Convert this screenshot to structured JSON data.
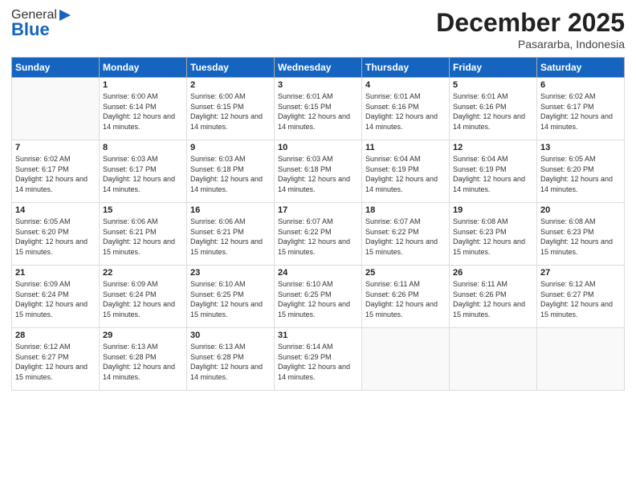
{
  "logo": {
    "general": "General",
    "blue": "Blue"
  },
  "title": "December 2025",
  "location": "Pasararba, Indonesia",
  "days_of_week": [
    "Sunday",
    "Monday",
    "Tuesday",
    "Wednesday",
    "Thursday",
    "Friday",
    "Saturday"
  ],
  "weeks": [
    [
      {
        "day": null,
        "sunrise": null,
        "sunset": null,
        "daylight": null
      },
      {
        "day": "1",
        "sunrise": "Sunrise: 6:00 AM",
        "sunset": "Sunset: 6:14 PM",
        "daylight": "Daylight: 12 hours and 14 minutes."
      },
      {
        "day": "2",
        "sunrise": "Sunrise: 6:00 AM",
        "sunset": "Sunset: 6:15 PM",
        "daylight": "Daylight: 12 hours and 14 minutes."
      },
      {
        "day": "3",
        "sunrise": "Sunrise: 6:01 AM",
        "sunset": "Sunset: 6:15 PM",
        "daylight": "Daylight: 12 hours and 14 minutes."
      },
      {
        "day": "4",
        "sunrise": "Sunrise: 6:01 AM",
        "sunset": "Sunset: 6:16 PM",
        "daylight": "Daylight: 12 hours and 14 minutes."
      },
      {
        "day": "5",
        "sunrise": "Sunrise: 6:01 AM",
        "sunset": "Sunset: 6:16 PM",
        "daylight": "Daylight: 12 hours and 14 minutes."
      },
      {
        "day": "6",
        "sunrise": "Sunrise: 6:02 AM",
        "sunset": "Sunset: 6:17 PM",
        "daylight": "Daylight: 12 hours and 14 minutes."
      }
    ],
    [
      {
        "day": "7",
        "sunrise": "Sunrise: 6:02 AM",
        "sunset": "Sunset: 6:17 PM",
        "daylight": "Daylight: 12 hours and 14 minutes."
      },
      {
        "day": "8",
        "sunrise": "Sunrise: 6:03 AM",
        "sunset": "Sunset: 6:17 PM",
        "daylight": "Daylight: 12 hours and 14 minutes."
      },
      {
        "day": "9",
        "sunrise": "Sunrise: 6:03 AM",
        "sunset": "Sunset: 6:18 PM",
        "daylight": "Daylight: 12 hours and 14 minutes."
      },
      {
        "day": "10",
        "sunrise": "Sunrise: 6:03 AM",
        "sunset": "Sunset: 6:18 PM",
        "daylight": "Daylight: 12 hours and 14 minutes."
      },
      {
        "day": "11",
        "sunrise": "Sunrise: 6:04 AM",
        "sunset": "Sunset: 6:19 PM",
        "daylight": "Daylight: 12 hours and 14 minutes."
      },
      {
        "day": "12",
        "sunrise": "Sunrise: 6:04 AM",
        "sunset": "Sunset: 6:19 PM",
        "daylight": "Daylight: 12 hours and 14 minutes."
      },
      {
        "day": "13",
        "sunrise": "Sunrise: 6:05 AM",
        "sunset": "Sunset: 6:20 PM",
        "daylight": "Daylight: 12 hours and 14 minutes."
      }
    ],
    [
      {
        "day": "14",
        "sunrise": "Sunrise: 6:05 AM",
        "sunset": "Sunset: 6:20 PM",
        "daylight": "Daylight: 12 hours and 15 minutes."
      },
      {
        "day": "15",
        "sunrise": "Sunrise: 6:06 AM",
        "sunset": "Sunset: 6:21 PM",
        "daylight": "Daylight: 12 hours and 15 minutes."
      },
      {
        "day": "16",
        "sunrise": "Sunrise: 6:06 AM",
        "sunset": "Sunset: 6:21 PM",
        "daylight": "Daylight: 12 hours and 15 minutes."
      },
      {
        "day": "17",
        "sunrise": "Sunrise: 6:07 AM",
        "sunset": "Sunset: 6:22 PM",
        "daylight": "Daylight: 12 hours and 15 minutes."
      },
      {
        "day": "18",
        "sunrise": "Sunrise: 6:07 AM",
        "sunset": "Sunset: 6:22 PM",
        "daylight": "Daylight: 12 hours and 15 minutes."
      },
      {
        "day": "19",
        "sunrise": "Sunrise: 6:08 AM",
        "sunset": "Sunset: 6:23 PM",
        "daylight": "Daylight: 12 hours and 15 minutes."
      },
      {
        "day": "20",
        "sunrise": "Sunrise: 6:08 AM",
        "sunset": "Sunset: 6:23 PM",
        "daylight": "Daylight: 12 hours and 15 minutes."
      }
    ],
    [
      {
        "day": "21",
        "sunrise": "Sunrise: 6:09 AM",
        "sunset": "Sunset: 6:24 PM",
        "daylight": "Daylight: 12 hours and 15 minutes."
      },
      {
        "day": "22",
        "sunrise": "Sunrise: 6:09 AM",
        "sunset": "Sunset: 6:24 PM",
        "daylight": "Daylight: 12 hours and 15 minutes."
      },
      {
        "day": "23",
        "sunrise": "Sunrise: 6:10 AM",
        "sunset": "Sunset: 6:25 PM",
        "daylight": "Daylight: 12 hours and 15 minutes."
      },
      {
        "day": "24",
        "sunrise": "Sunrise: 6:10 AM",
        "sunset": "Sunset: 6:25 PM",
        "daylight": "Daylight: 12 hours and 15 minutes."
      },
      {
        "day": "25",
        "sunrise": "Sunrise: 6:11 AM",
        "sunset": "Sunset: 6:26 PM",
        "daylight": "Daylight: 12 hours and 15 minutes."
      },
      {
        "day": "26",
        "sunrise": "Sunrise: 6:11 AM",
        "sunset": "Sunset: 6:26 PM",
        "daylight": "Daylight: 12 hours and 15 minutes."
      },
      {
        "day": "27",
        "sunrise": "Sunrise: 6:12 AM",
        "sunset": "Sunset: 6:27 PM",
        "daylight": "Daylight: 12 hours and 15 minutes."
      }
    ],
    [
      {
        "day": "28",
        "sunrise": "Sunrise: 6:12 AM",
        "sunset": "Sunset: 6:27 PM",
        "daylight": "Daylight: 12 hours and 15 minutes."
      },
      {
        "day": "29",
        "sunrise": "Sunrise: 6:13 AM",
        "sunset": "Sunset: 6:28 PM",
        "daylight": "Daylight: 12 hours and 14 minutes."
      },
      {
        "day": "30",
        "sunrise": "Sunrise: 6:13 AM",
        "sunset": "Sunset: 6:28 PM",
        "daylight": "Daylight: 12 hours and 14 minutes."
      },
      {
        "day": "31",
        "sunrise": "Sunrise: 6:14 AM",
        "sunset": "Sunset: 6:29 PM",
        "daylight": "Daylight: 12 hours and 14 minutes."
      },
      {
        "day": null,
        "sunrise": null,
        "sunset": null,
        "daylight": null
      },
      {
        "day": null,
        "sunrise": null,
        "sunset": null,
        "daylight": null
      },
      {
        "day": null,
        "sunrise": null,
        "sunset": null,
        "daylight": null
      }
    ]
  ]
}
